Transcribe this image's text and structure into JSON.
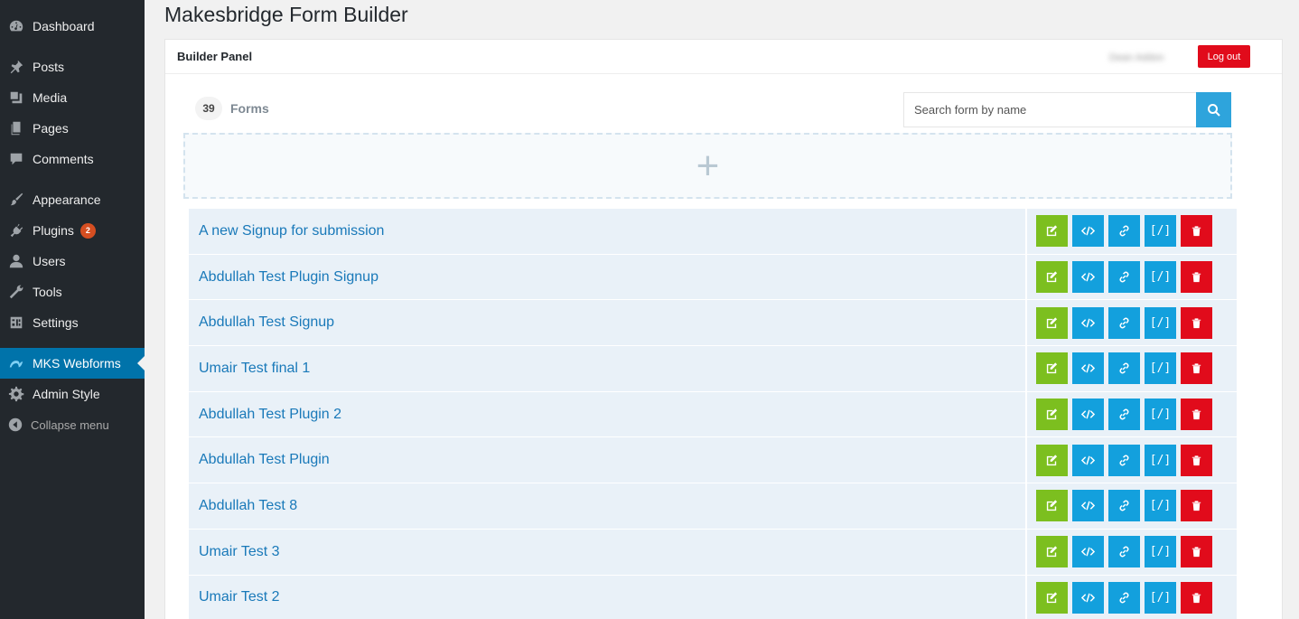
{
  "sidebar": {
    "items": [
      {
        "label": "Dashboard",
        "icon": "dashboard-icon"
      },
      {
        "label": "Posts",
        "icon": "pin-icon"
      },
      {
        "label": "Media",
        "icon": "media-icon"
      },
      {
        "label": "Pages",
        "icon": "pages-icon"
      },
      {
        "label": "Comments",
        "icon": "comments-icon"
      },
      {
        "label": "Appearance",
        "icon": "brush-icon"
      },
      {
        "label": "Plugins",
        "icon": "plugin-icon",
        "badge": "2"
      },
      {
        "label": "Users",
        "icon": "user-icon"
      },
      {
        "label": "Tools",
        "icon": "wrench-icon"
      },
      {
        "label": "Settings",
        "icon": "settings-icon"
      },
      {
        "label": "MKS Webforms",
        "icon": "mks-logo-icon",
        "active": true
      },
      {
        "label": "Admin Style",
        "icon": "gear-icon"
      },
      {
        "label": "Collapse menu",
        "icon": "collapse-icon"
      }
    ]
  },
  "page": {
    "title": "Makesbridge Form Builder"
  },
  "panel": {
    "title": "Builder Panel",
    "user_name": "Dean Addon",
    "logout_label": "Log out",
    "form_count": "39",
    "forms_label": "Forms",
    "search_placeholder": "Search form by name",
    "add_symbol": "+"
  },
  "forms": [
    "A new Signup for submission",
    "Abdullah Test Plugin Signup",
    "Abdullah Test Signup",
    "Umair Test final 1",
    "Abdullah Test Plugin 2",
    "Abdullah Test Plugin",
    "Abdullah Test 8",
    "Umair Test 3",
    "Umair Test 2"
  ],
  "actions": {
    "shortcode_label": "[/]"
  },
  "colors": {
    "edit": "#7cbf1f",
    "action_blue": "#13a0dd",
    "delete": "#e10b1b",
    "sidebar_bg": "#23282d",
    "sidebar_active": "#0073aa"
  }
}
